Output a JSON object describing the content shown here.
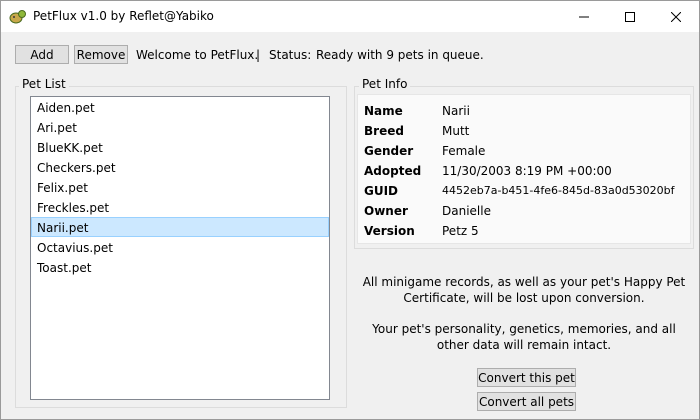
{
  "window": {
    "title": "PetFlux v1.0 by Reflet@Yabiko"
  },
  "toolbar": {
    "add_label": "Add",
    "remove_label": "Remove",
    "welcome": "Welcome to PetFlux.",
    "separator": "|",
    "status_label": "Status:",
    "status_value": "Ready with 9 pets in queue."
  },
  "pet_list": {
    "label": "Pet List",
    "items": [
      "Aiden.pet",
      "Ari.pet",
      "BlueKK.pet",
      "Checkers.pet",
      "Felix.pet",
      "Freckles.pet",
      "Narii.pet",
      "Octavius.pet",
      "Toast.pet"
    ],
    "selected": "Narii.pet"
  },
  "pet_info": {
    "label": "Pet Info",
    "rows": [
      {
        "key": "Name",
        "value": "Narii"
      },
      {
        "key": "Breed",
        "value": "Mutt"
      },
      {
        "key": "Gender",
        "value": "Female"
      },
      {
        "key": "Adopted",
        "value": "11/30/2003 8:19 PM +00:00"
      },
      {
        "key": "GUID",
        "value": "4452eb7a-b451-4fe6-845d-83a0d53020bf"
      },
      {
        "key": "Owner",
        "value": "Danielle"
      },
      {
        "key": "Version",
        "value": "Petz 5"
      }
    ]
  },
  "notice": {
    "line1": "All minigame records, as well as your pet's Happy Pet",
    "line2": "Certificate, will be lost upon conversion.",
    "line3": "Your pet's personality, genetics, memories, and all",
    "line4": "other data will remain intact."
  },
  "actions": {
    "convert_this": "Convert this pet",
    "convert_all": "Convert all pets"
  },
  "colors": {
    "selection": "#cce8ff",
    "selection_border": "#99d1ff",
    "focus_border": "#0078d7"
  }
}
